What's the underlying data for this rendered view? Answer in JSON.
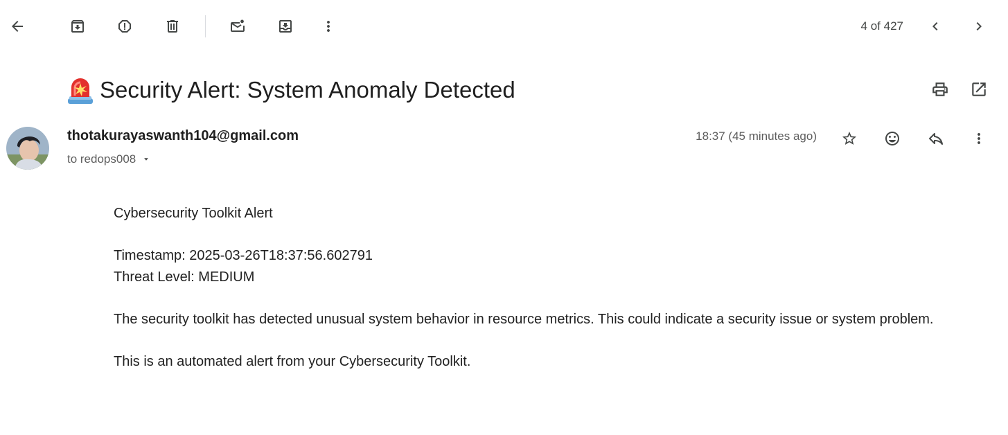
{
  "toolbar": {
    "back_icon": "arrow-back-icon",
    "archive_icon": "archive-icon",
    "report_spam_icon": "report-spam-icon",
    "delete_icon": "trash-icon",
    "mark_unread_icon": "mark-unread-icon",
    "move_to_icon": "move-to-inbox-icon",
    "more_icon": "more-vert-icon",
    "counter": "4 of 427",
    "prev_icon": "chevron-left-icon",
    "next_icon": "chevron-right-icon"
  },
  "subject": {
    "emoji": "🚨",
    "text": "Security Alert: System Anomaly Detected",
    "print_icon": "print-icon",
    "new_window_icon": "open-in-new-icon"
  },
  "message": {
    "sender_email": "thotakurayaswanth104@gmail.com",
    "recipient": "to redops008",
    "timestamp": "18:37 (45 minutes ago)",
    "star_icon": "star-icon",
    "emoji_icon": "emoji-reaction-icon",
    "reply_icon": "reply-icon",
    "more_icon": "more-vert-icon"
  },
  "body": {
    "line1": "Cybersecurity Toolkit Alert",
    "line2": "Timestamp: 2025-03-26T18:37:56.602791",
    "line3": "Threat Level: MEDIUM",
    "line4": "The security toolkit has detected unusual system behavior in resource metrics. This could indicate a security issue or system problem.",
    "line5": "This is an automated alert from your Cybersecurity Toolkit."
  },
  "colors": {
    "icon": "#444746",
    "text": "#1f1f1f",
    "muted": "#5e5e5e",
    "siren_red": "#e3312d",
    "siren_base": "#5aa0d8"
  }
}
